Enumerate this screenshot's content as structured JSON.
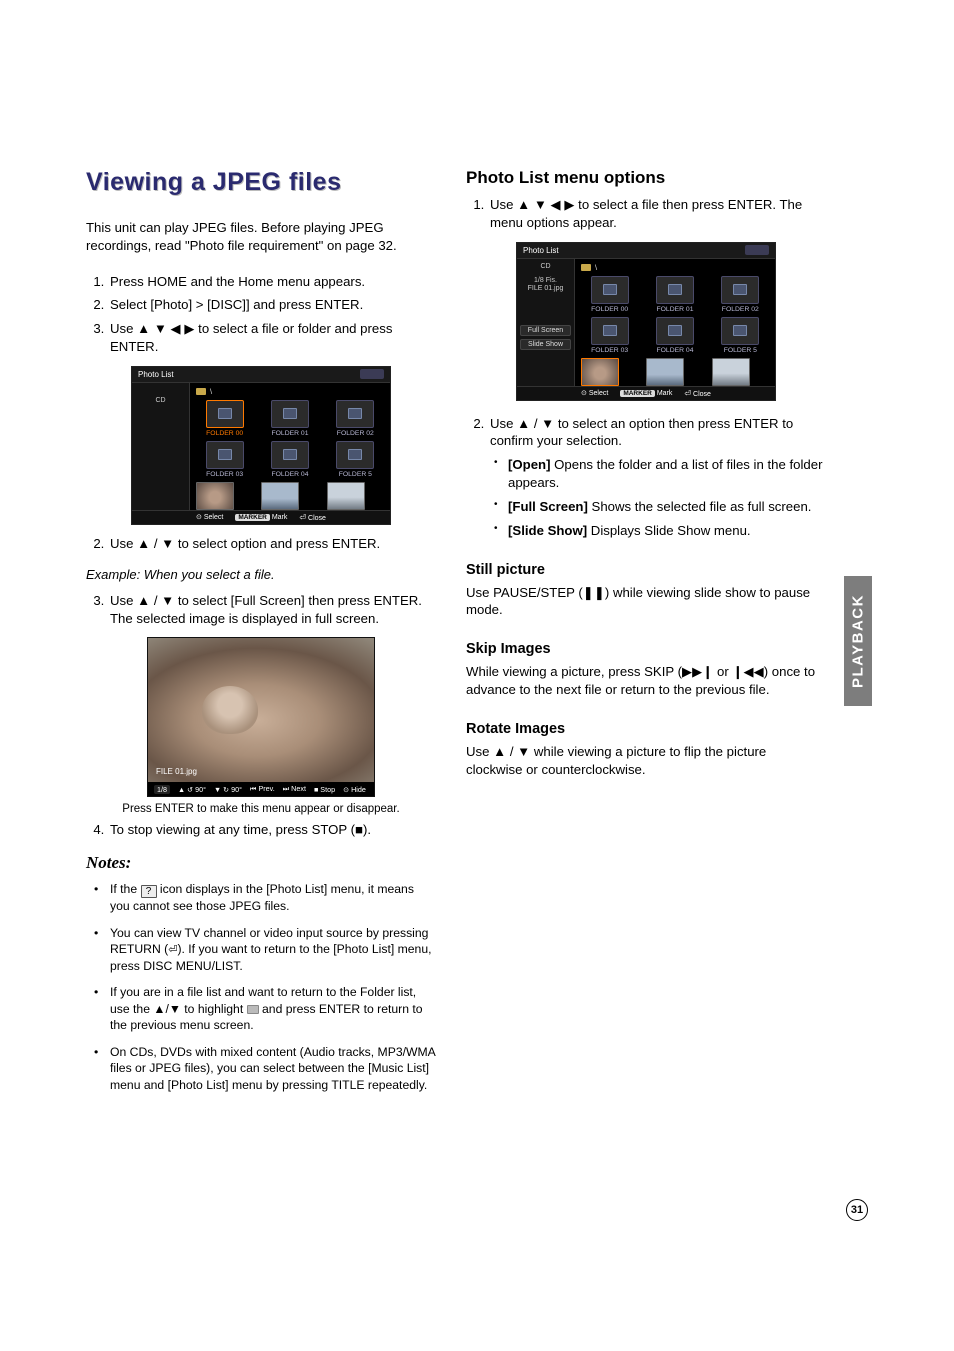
{
  "left": {
    "title": "Viewing a JPEG files",
    "intro": "This unit can play JPEG files. Before playing JPEG recordings, read \"Photo file requirement\" on page 32.",
    "step1": "Press HOME and the Home menu appears.",
    "step2": "Select [Photo] > [DISC]] and press ENTER.",
    "step3a": "Use ",
    "step3b": " to select a file or folder and press ENTER.",
    "step2b": "Use ",
    "step2c": " to select option and press ENTER.",
    "example": "Example: When you select a file.",
    "step3_2a": "Use ",
    "step3_2b": " to select [Full Screen] then press ENTER.",
    "step3_2c": "The selected image is displayed in full screen.",
    "caption": "Press ENTER to make this menu appear or disappear.",
    "step4a": "To stop viewing at any time, press STOP (",
    "step4b": ").",
    "notes_heading": "Notes:",
    "note1a": "If the ",
    "note1b": " icon displays in the [Photo List] menu, it means you cannot see those JPEG files.",
    "note2a": "You can view TV channel or video input source by pressing RETURN (",
    "note2b": "). If you want to return to the [Photo List] menu, press DISC MENU/LIST.",
    "note3a": "If you are in a file list and want to return to the Folder list, use the ",
    "note3b": " to highlight ",
    "note3c": " and press ENTER to return to the previous menu screen.",
    "note4": "On CDs, DVDs with mixed content (Audio tracks, MP3/WMA files or JPEG files), you can select between the [Music List] menu and [Photo List] menu by pressing TITLE repeatedly."
  },
  "right": {
    "h_menu": "Photo List menu options",
    "s1a": "Use ",
    "s1b": " to select a file then press ENTER. The menu options appear.",
    "s2a": "Use ",
    "s2b": " to select an option then press ENTER to confirm your selection.",
    "opt1a": "[Open]",
    "opt1b": " Opens the folder and a list of files in the folder appears.",
    "opt2a": "[Full Screen]",
    "opt2b": " Shows the selected file as full screen.",
    "opt3a": "[Slide Show]",
    "opt3b": " Displays Slide Show menu.",
    "h_still": "Still picture",
    "still_a": "Use PAUSE/STEP (",
    "still_b": ") while viewing slide show to pause mode.",
    "h_skip": "Skip Images",
    "skip_a": "While viewing a picture, press SKIP (",
    "skip_b": " or ",
    "skip_c": ") once to advance to the next file or return to the previous file.",
    "h_rot": "Rotate Images",
    "rot_a": "Use ",
    "rot_b": " while viewing a picture to flip the picture clockwise or counterclockwise."
  },
  "photolist": {
    "title": "Photo List",
    "crumb": "\\",
    "cd": "CD",
    "side_info_a": "1/8 Fis.",
    "side_info_b": "FILE 01.jpg",
    "btn_full": "Full Screen",
    "btn_slide": "Slide Show",
    "folders": [
      "FOLDER 00",
      "FOLDER 01",
      "FOLDER 02",
      "FOLDER 03",
      "FOLDER 04",
      "FOLDER 5"
    ],
    "footer_select": "Select",
    "footer_mark_pill": "MARKER",
    "footer_mark": "Mark",
    "footer_close": "Close"
  },
  "fullcat": {
    "label": "FILE 01.jpg",
    "count": "1/8",
    "bar_items": [
      "▲ ↺ 90°",
      "▼ ↻ 90°",
      "⏮ Prev.",
      "⏭ Next",
      "■ Stop",
      "⊙ Hide"
    ]
  },
  "sidetab": "PLAYBACK",
  "page_num": "31",
  "glyphs": {
    "q": "?",
    "udlr": "▲ ▼ ◀ ▶",
    "ud_slash": "▲ / ▼",
    "ud": "▲/▼",
    "stop": "■",
    "pause": "❚❚",
    "next": "▶▶❙",
    "prev": "❙◀◀",
    "return": "↩",
    "return_icon": "⏎"
  }
}
